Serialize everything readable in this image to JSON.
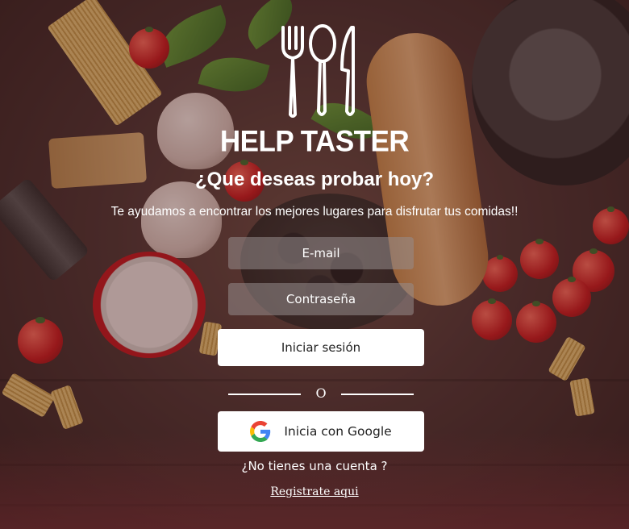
{
  "brand": {
    "name": "HELP TASTER",
    "logo_icon": "fork-spoon-knife-icon"
  },
  "hero": {
    "headline": "¿Que deseas probar hoy?",
    "subtitle": "Te ayudamos a encontrar los mejores lugares para disfrutar tus comidas!!"
  },
  "form": {
    "email_placeholder": "E-mail",
    "email_value": "",
    "password_placeholder": "Contraseña",
    "password_value": "",
    "login_label": "Iniciar sesión",
    "divider_text": "O",
    "google_label": "Inicia con Google",
    "google_icon": "google-g-icon"
  },
  "footer": {
    "no_account_text": "¿No tienes una cuenta ?",
    "register_link": "Registrate aqui"
  },
  "colors": {
    "overlay": "#46201e",
    "field_bg": "#968c8c",
    "button_bg": "#ffffff",
    "text": "#ffffff"
  }
}
